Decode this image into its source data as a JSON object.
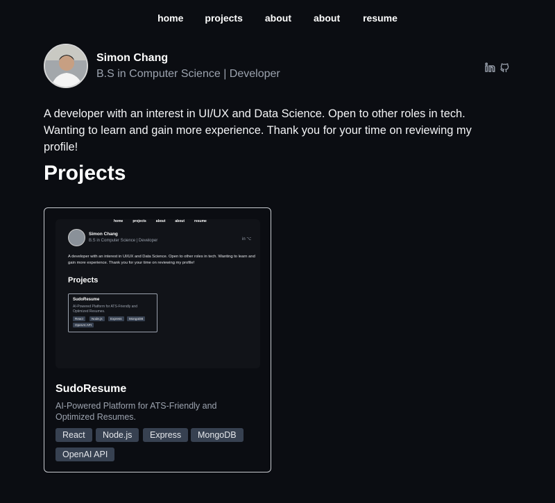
{
  "nav": {
    "items": [
      {
        "label": "home"
      },
      {
        "label": "projects"
      },
      {
        "label": "about"
      },
      {
        "label": "about"
      },
      {
        "label": "resume"
      }
    ]
  },
  "profile": {
    "name": "Simon Chang",
    "subtitle": "B.S in Computer Science | Developer",
    "icons": [
      "linkedin-icon",
      "github-icon"
    ]
  },
  "bio": "A developer with an interest in UI/UX and Data Science. Open to other roles in tech. Wanting to learn and gain more experience. Thank you for your time on reviewing my profile!",
  "projects": {
    "title": "Projects",
    "items": [
      {
        "title": "SudoResume",
        "description": "AI-Powered Platform for ATS-Friendly and Optimized Resumes.",
        "tags": [
          "React",
          "Node.js",
          "Express",
          "MongoDB",
          "OpenAI API"
        ],
        "thumbnail": {
          "nav": [
            "home",
            "projects",
            "about",
            "about",
            "resume"
          ],
          "name": "Simon Chang",
          "subtitle": "B.S in Computer Science | Developer",
          "social": "in ⌥",
          "bio": "A developer with an interest in UI/UX and Data Science. Open to other roles in tech. Wanting to learn and gain more experience. Thank you for your time on reviewing my profile!",
          "projects_title": "Projects",
          "card_title": "SudoResume",
          "card_desc": "AI-Powered Platform for ATS-Friendly and Optimized Resumes.",
          "tags": [
            "React",
            "Node.js",
            "Express",
            "MongoDB",
            "OpenAI API"
          ]
        }
      }
    ]
  },
  "colors": {
    "background": "#0b0d12",
    "muted_text": "#9ca3af",
    "tag_bg": "#374151",
    "card_border": "#c9ccd1"
  }
}
